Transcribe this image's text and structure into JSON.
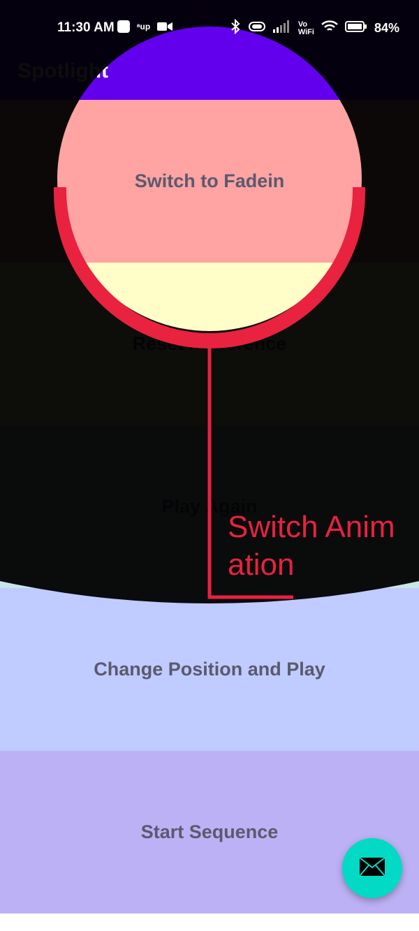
{
  "status_bar": {
    "time": "11:30 AM",
    "up_label": "ᵃup",
    "vo_wifi_label": "Vo\nWiFi",
    "battery_percent": "84%"
  },
  "app_bar": {
    "title": "Spotlight"
  },
  "list": {
    "items": [
      {
        "label": "Switch to Fadein"
      },
      {
        "label": "Reset Preference"
      },
      {
        "label": "Play Again"
      },
      {
        "label": "Change Position and Play"
      },
      {
        "label": "Start Sequence"
      }
    ]
  },
  "spotlight": {
    "label": "Switch Animation",
    "accent_color": "#e8223f",
    "overlay_color": "#000000"
  },
  "fab": {
    "icon": "mail-icon"
  },
  "colors": {
    "primary": "#6200ee",
    "fab": "#03dac5"
  }
}
